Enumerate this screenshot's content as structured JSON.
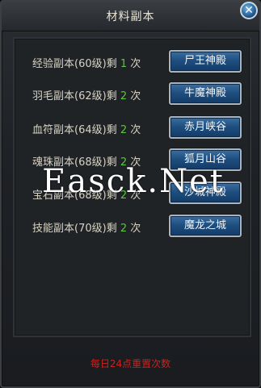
{
  "window": {
    "title": "材料副本"
  },
  "rows": [
    {
      "name": "经验副本",
      "level": "(60级)",
      "remain": "剩",
      "count": "1",
      "unit": "次",
      "button": "尸王神殿"
    },
    {
      "name": "羽毛副本",
      "level": "(62级)",
      "remain": "剩",
      "count": "2",
      "unit": "次",
      "button": "牛魔神殿"
    },
    {
      "name": "血符副本",
      "level": "(64级)",
      "remain": "剩",
      "count": "2",
      "unit": "次",
      "button": "赤月峡谷"
    },
    {
      "name": "魂珠副本",
      "level": "(68级)",
      "remain": "剩",
      "count": "2",
      "unit": "次",
      "button": "狐月山谷"
    },
    {
      "name": "宝石副本",
      "level": "(68级)",
      "remain": "剩",
      "count": "2",
      "unit": "次",
      "button": "沙城神殿"
    },
    {
      "name": "技能副本",
      "level": "(70级)",
      "remain": "剩",
      "count": "2",
      "unit": "次",
      "button": "魔龙之城"
    }
  ],
  "footer": "每日24点重置次数",
  "watermark": "Easck.Net",
  "colors": {
    "count": "#59c640",
    "footer": "#c8231e",
    "button": "#1e4f80"
  }
}
